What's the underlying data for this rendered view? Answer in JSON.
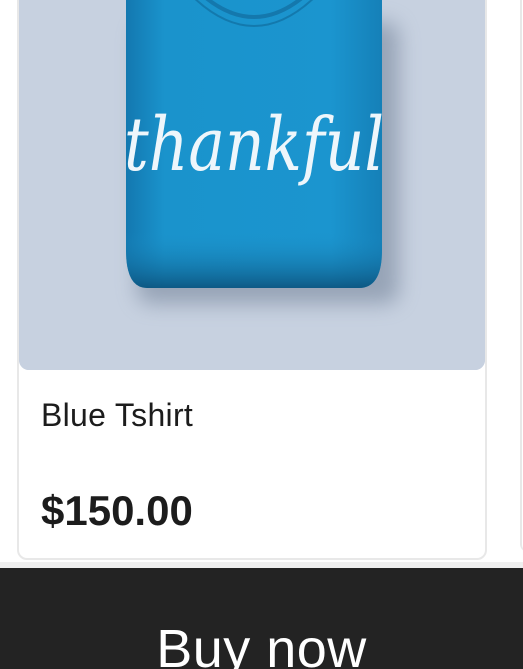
{
  "product": {
    "name": "Blue Tshirt",
    "price": "$150.00",
    "image_text": "thankful",
    "image_alt": "blue-tshirt-image"
  },
  "actions": {
    "buy_label": "Buy now"
  },
  "colors": {
    "shirt": "#1a8fc4",
    "image_background": "#c7d1e0",
    "buy_bar": "#232323"
  }
}
